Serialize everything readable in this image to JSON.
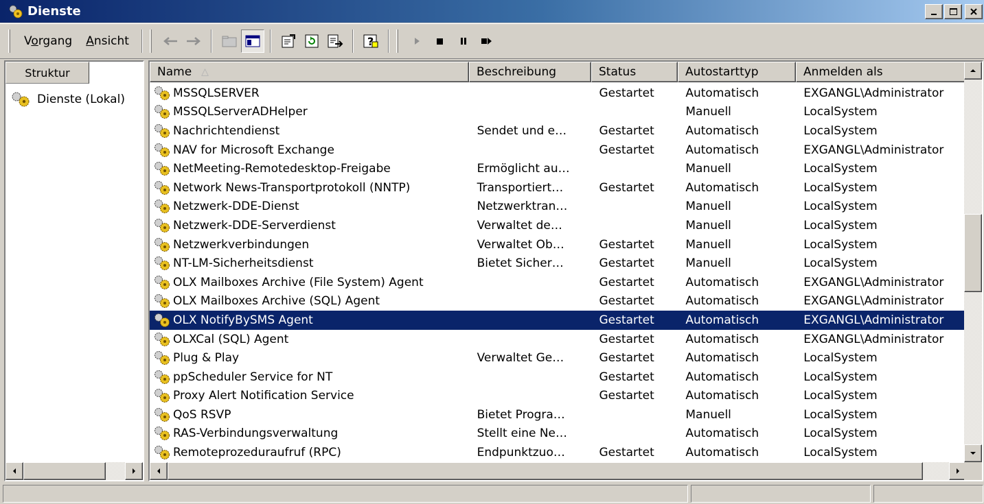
{
  "window": {
    "title": "Dienste",
    "icon": "services-gear-icon",
    "controls": {
      "minimize": "_",
      "maximize": "□",
      "close": "×"
    }
  },
  "menu": {
    "items": [
      {
        "label": "Vorgang",
        "underline": "o"
      },
      {
        "label": "Ansicht",
        "underline": "A"
      }
    ]
  },
  "toolbar": {
    "tools": [
      "back-arrow-icon",
      "forward-arrow-icon",
      "up-folder-icon",
      "show-hide-tree-icon",
      "properties-icon",
      "refresh-icon",
      "export-list-icon",
      "help-icon",
      "start-service-icon",
      "stop-service-icon",
      "pause-service-icon",
      "restart-service-icon"
    ]
  },
  "tree": {
    "tab_label": "Struktur",
    "root_label": "Dienste (Lokal)"
  },
  "list": {
    "columns": [
      "Name",
      "Beschreibung",
      "Status",
      "Autostarttyp",
      "Anmelden als"
    ],
    "sort_indicator": "△",
    "rows": [
      {
        "name": "MSSQLSERVER",
        "desc": "",
        "status": "Gestartet",
        "start": "Automatisch",
        "user": "EXGANGL\\Administrator"
      },
      {
        "name": "MSSQLServerADHelper",
        "desc": "",
        "status": "",
        "start": "Manuell",
        "user": "LocalSystem"
      },
      {
        "name": "Nachrichtendienst",
        "desc": "Sendet und e…",
        "status": "Gestartet",
        "start": "Automatisch",
        "user": "LocalSystem"
      },
      {
        "name": "NAV for Microsoft Exchange",
        "desc": "",
        "status": "Gestartet",
        "start": "Automatisch",
        "user": "EXGANGL\\Administrator"
      },
      {
        "name": "NetMeeting-Remotedesktop-Freigabe",
        "desc": "Ermöglicht au…",
        "status": "",
        "start": "Manuell",
        "user": "LocalSystem"
      },
      {
        "name": "Network News-Transportprotokoll (NNTP)",
        "desc": "Transportiert…",
        "status": "Gestartet",
        "start": "Automatisch",
        "user": "LocalSystem"
      },
      {
        "name": "Netzwerk-DDE-Dienst",
        "desc": "Netzwerktran…",
        "status": "",
        "start": "Manuell",
        "user": "LocalSystem"
      },
      {
        "name": "Netzwerk-DDE-Serverdienst",
        "desc": "Verwaltet de…",
        "status": "",
        "start": "Manuell",
        "user": "LocalSystem"
      },
      {
        "name": "Netzwerkverbindungen",
        "desc": "Verwaltet Ob…",
        "status": "Gestartet",
        "start": "Manuell",
        "user": "LocalSystem"
      },
      {
        "name": "NT-LM-Sicherheitsdienst",
        "desc": "Bietet Sicher…",
        "status": "Gestartet",
        "start": "Manuell",
        "user": "LocalSystem"
      },
      {
        "name": "OLX Mailboxes Archive (File System) Agent",
        "desc": "",
        "status": "Gestartet",
        "start": "Automatisch",
        "user": "EXGANGL\\Administrator"
      },
      {
        "name": "OLX Mailboxes Archive (SQL) Agent",
        "desc": "",
        "status": "Gestartet",
        "start": "Automatisch",
        "user": "EXGANGL\\Administrator"
      },
      {
        "name": "OLX NotifyBySMS Agent",
        "desc": "",
        "status": "Gestartet",
        "start": "Automatisch",
        "user": "EXGANGL\\Administrator",
        "selected": true
      },
      {
        "name": "OLXCal (SQL) Agent",
        "desc": "",
        "status": "Gestartet",
        "start": "Automatisch",
        "user": "EXGANGL\\Administrator"
      },
      {
        "name": "Plug & Play",
        "desc": "Verwaltet Ge…",
        "status": "Gestartet",
        "start": "Automatisch",
        "user": "LocalSystem"
      },
      {
        "name": "ppScheduler Service for NT",
        "desc": "",
        "status": "Gestartet",
        "start": "Automatisch",
        "user": "LocalSystem"
      },
      {
        "name": "Proxy Alert Notification Service",
        "desc": "",
        "status": "Gestartet",
        "start": "Automatisch",
        "user": "LocalSystem"
      },
      {
        "name": "QoS RSVP",
        "desc": "Bietet Progra…",
        "status": "",
        "start": "Manuell",
        "user": "LocalSystem"
      },
      {
        "name": "RAS-Verbindungsverwaltung",
        "desc": "Stellt eine Ne…",
        "status": "",
        "start": "Automatisch",
        "user": "LocalSystem"
      },
      {
        "name": "Remoteprozeduraufruf (RPC)",
        "desc": "Endpunktzuo…",
        "status": "Gestartet",
        "start": "Automatisch",
        "user": "LocalSystem"
      }
    ]
  },
  "colors": {
    "selection": "#0a246a",
    "face": "#d4d0c8",
    "title_start": "#0a246a",
    "title_end": "#a6caf0"
  }
}
